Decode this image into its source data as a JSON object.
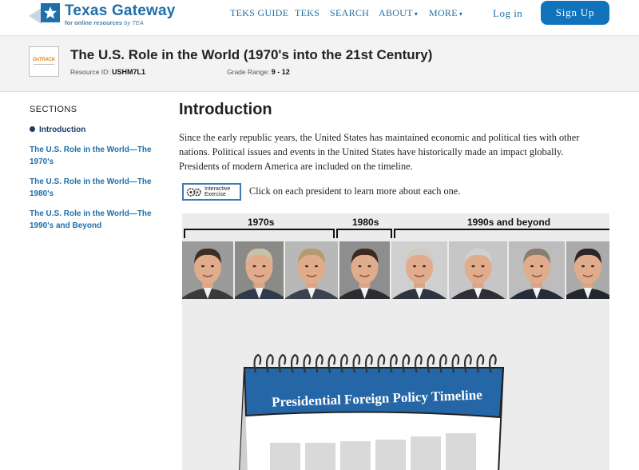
{
  "brand": {
    "name": "Texas Gateway",
    "tagline": "for online resources",
    "tagline_by": "by TEA",
    "color": "#1f6fa8"
  },
  "nav": {
    "links": [
      {
        "label": "TEKS GUIDE"
      },
      {
        "label": "TEKS"
      },
      {
        "label": "SEARCH"
      },
      {
        "label": "ABOUT",
        "caret": "▾"
      },
      {
        "label": "MORE",
        "caret": "▾"
      }
    ],
    "login_label": "Log in",
    "signup_label": "Sign Up",
    "signup_color": "#1273bd"
  },
  "resource": {
    "logo_text": "OnTRACK",
    "title": "The U.S. Role in the World (1970's into the 21st Century)",
    "id_label": "Resource ID:",
    "id_value": "USHM7L1",
    "grade_label": "Grade Range:",
    "grade_value": "9 - 12"
  },
  "sidebar": {
    "title": "SECTIONS",
    "items": [
      {
        "label": "Introduction",
        "active": true
      },
      {
        "label": "The U.S. Role in the World—The 1970's"
      },
      {
        "label": "The U.S. Role in the World—The 1980's"
      },
      {
        "label": "The U.S. Role in the World—The 1990's and Beyond"
      }
    ]
  },
  "main": {
    "title": "Introduction",
    "paragraph": "Since the early republic years, the United States has maintained economic and political ties with other nations. Political issues and events in the United States have historically made an impact globally. Presidents of modern America are included on the timeline.",
    "exercise_badge_line1": "Interactive",
    "exercise_badge_line2": "Exercise",
    "exercise_instruction": "Click on each president to learn more about each one."
  },
  "timeline": {
    "eras": [
      {
        "label": "1970s"
      },
      {
        "label": "1980s"
      },
      {
        "label": "1990s and beyond"
      }
    ],
    "presidents": [
      {
        "id": "nixon",
        "suit": "#3a3a3a",
        "hair": "#3b2e25",
        "bg": "#9a9a9a"
      },
      {
        "id": "ford",
        "suit": "#2f3b4a",
        "hair": "#c8c0a8",
        "bg": "#8a8a86"
      },
      {
        "id": "carter",
        "suit": "#3b4350",
        "hair": "#b49a70",
        "bg": "#b8b8b8"
      },
      {
        "id": "reagan",
        "suit": "#2b2b30",
        "hair": "#3a2a1f",
        "bg": "#8e8e8e"
      },
      {
        "id": "bush-sr",
        "suit": "#2e3440",
        "hair": "#d0cac0",
        "bg": "#cfcfcf"
      },
      {
        "id": "clinton",
        "suit": "#2e2e36",
        "hair": "#cfd0d0",
        "bg": "#c6c6c6"
      },
      {
        "id": "bush-jr",
        "suit": "#262c38",
        "hair": "#8a7d70",
        "bg": "#bdbdbd"
      },
      {
        "id": "obama",
        "suit": "#23262c",
        "hair": "#2b2624",
        "bg": "#aaaaaa"
      }
    ],
    "calendar_title": "Presidential Foreign Policy Timeline",
    "calendar_color": "#2466a6"
  }
}
